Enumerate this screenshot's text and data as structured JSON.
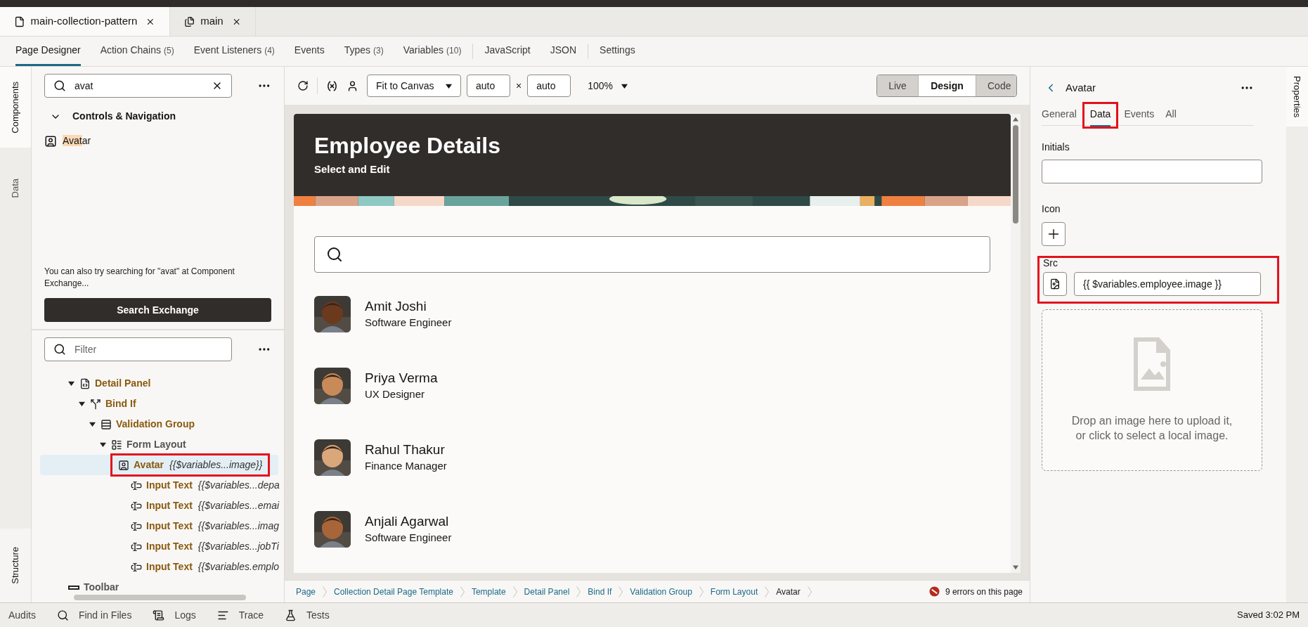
{
  "file_tabs": [
    {
      "label": "main-collection-pattern",
      "kind": "file",
      "selected": true
    },
    {
      "label": "main",
      "kind": "files",
      "selected": false
    }
  ],
  "nav_tab_groups": [
    [
      {
        "label": "Page Designer",
        "selected": true
      },
      {
        "label": "Action Chains",
        "count": "(5)",
        "selected": false
      },
      {
        "label": "Event Listeners",
        "count": "(4)",
        "selected": false
      },
      {
        "label": "Events",
        "selected": false
      },
      {
        "label": "Types",
        "count": "(3)",
        "selected": false
      },
      {
        "label": "Variables",
        "count": "(10)",
        "selected": false
      }
    ],
    [
      {
        "label": "JavaScript",
        "selected": false
      },
      {
        "label": "JSON",
        "selected": false
      }
    ],
    [
      {
        "label": "Settings",
        "selected": false
      }
    ]
  ],
  "left_rail": [
    {
      "label": "Components",
      "selected": true
    },
    {
      "label": "Data",
      "selected": false
    }
  ],
  "left_rail_bottom": {
    "label": "Structure"
  },
  "components": {
    "search_value": "avat",
    "group": {
      "label": "Controls & Navigation",
      "expanded": true
    },
    "items": [
      {
        "match": "Avat",
        "rest": "ar"
      }
    ],
    "hint": "You can also try searching for \"avat\" at Component Exchange...",
    "button": "Search Exchange"
  },
  "structure": {
    "filter_placeholder": "Filter",
    "tree": [
      {
        "label": "Detail Panel",
        "kind": "detail-panel",
        "expanded": true,
        "selected": false,
        "annotated": false,
        "children": [
          {
            "label": "Bind If",
            "kind": "bind-if",
            "expanded": true,
            "selected": false,
            "annotated": false,
            "children": [
              {
                "label": "Validation Group",
                "kind": "validation-group",
                "expanded": true,
                "selected": false,
                "annotated": false,
                "children": [
                  {
                    "label": "Form Layout",
                    "kind": "form-layout",
                    "expanded": true,
                    "selected": false,
                    "annotated": false,
                    "children": [
                      {
                        "label": "Avatar",
                        "binding": "{{$variables...image}}",
                        "kind": "avatar",
                        "selected": true,
                        "annotated": true
                      },
                      {
                        "label": "Input Text",
                        "binding": "{{$variables...depa",
                        "kind": "input-text",
                        "selected": false,
                        "annotated": false
                      },
                      {
                        "label": "Input Text",
                        "binding": "{{$variables...emai",
                        "kind": "input-text",
                        "selected": false,
                        "annotated": false
                      },
                      {
                        "label": "Input Text",
                        "binding": "{{$variables...imag",
                        "kind": "input-text",
                        "selected": false,
                        "annotated": false
                      },
                      {
                        "label": "Input Text",
                        "binding": "{{$variables...jobTi",
                        "kind": "input-text",
                        "selected": false,
                        "annotated": false
                      },
                      {
                        "label": "Input Text",
                        "binding": "{{$variables.emplo",
                        "kind": "input-text",
                        "selected": false,
                        "annotated": false
                      }
                    ]
                  }
                ]
              }
            ]
          }
        ]
      },
      {
        "label": "Toolbar",
        "kind": "toolbar",
        "selected": false,
        "annotated": false
      }
    ]
  },
  "canvas_toolbar": {
    "fit": "Fit to Canvas",
    "width": "auto",
    "times": "×",
    "height": "auto",
    "zoom": "100%",
    "modes": [
      {
        "label": "Live",
        "selected": false
      },
      {
        "label": "Design",
        "selected": true
      },
      {
        "label": "Code",
        "selected": false
      }
    ]
  },
  "preview": {
    "title": "Employee Details",
    "subtitle": "Select and Edit",
    "employees": [
      {
        "name": "Amit Joshi",
        "role": "Software Engineer",
        "color": "#6b3a1e"
      },
      {
        "name": "Priya Verma",
        "role": "UX Designer",
        "color": "#c98a5a"
      },
      {
        "name": "Rahul Thakur",
        "role": "Finance Manager",
        "color": "#d9a77a"
      },
      {
        "name": "Anjali Agarwal",
        "role": "Software Engineer",
        "color": "#a8653a"
      }
    ]
  },
  "breadcrumbs": [
    {
      "label": "Page",
      "selected": false
    },
    {
      "label": "Collection Detail Page Template",
      "selected": false
    },
    {
      "label": "Template",
      "selected": false
    },
    {
      "label": "Detail Panel",
      "selected": false
    },
    {
      "label": "Bind If",
      "selected": false
    },
    {
      "label": "Validation Group",
      "selected": false
    },
    {
      "label": "Form Layout",
      "selected": false
    },
    {
      "label": "Avatar",
      "selected": true
    }
  ],
  "errors": "9 errors on this page",
  "properties": {
    "title": "Avatar",
    "tabs": [
      {
        "label": "General",
        "selected": false,
        "annotated": false
      },
      {
        "label": "Data",
        "selected": true,
        "annotated": true
      },
      {
        "label": "Events",
        "selected": false,
        "annotated": false
      },
      {
        "label": "All",
        "selected": false,
        "annotated": false
      }
    ],
    "initials_label": "Initials",
    "icon_label": "Icon",
    "src_label": "Src",
    "src_value": "{{ $variables.employee.image }}",
    "src_annotated": true,
    "drop_text": "Drop an image here to upload it, or click to select a local image."
  },
  "right_rail": {
    "label": "Properties"
  },
  "bottom_bar": {
    "items": [
      {
        "label": "Audits",
        "kind": "none"
      },
      {
        "label": "Find in Files",
        "kind": "search"
      },
      {
        "label": "Logs",
        "kind": "logs"
      },
      {
        "label": "Trace",
        "kind": "trace"
      },
      {
        "label": "Tests",
        "kind": "tests"
      }
    ],
    "status": "Saved 3:02 PM"
  }
}
